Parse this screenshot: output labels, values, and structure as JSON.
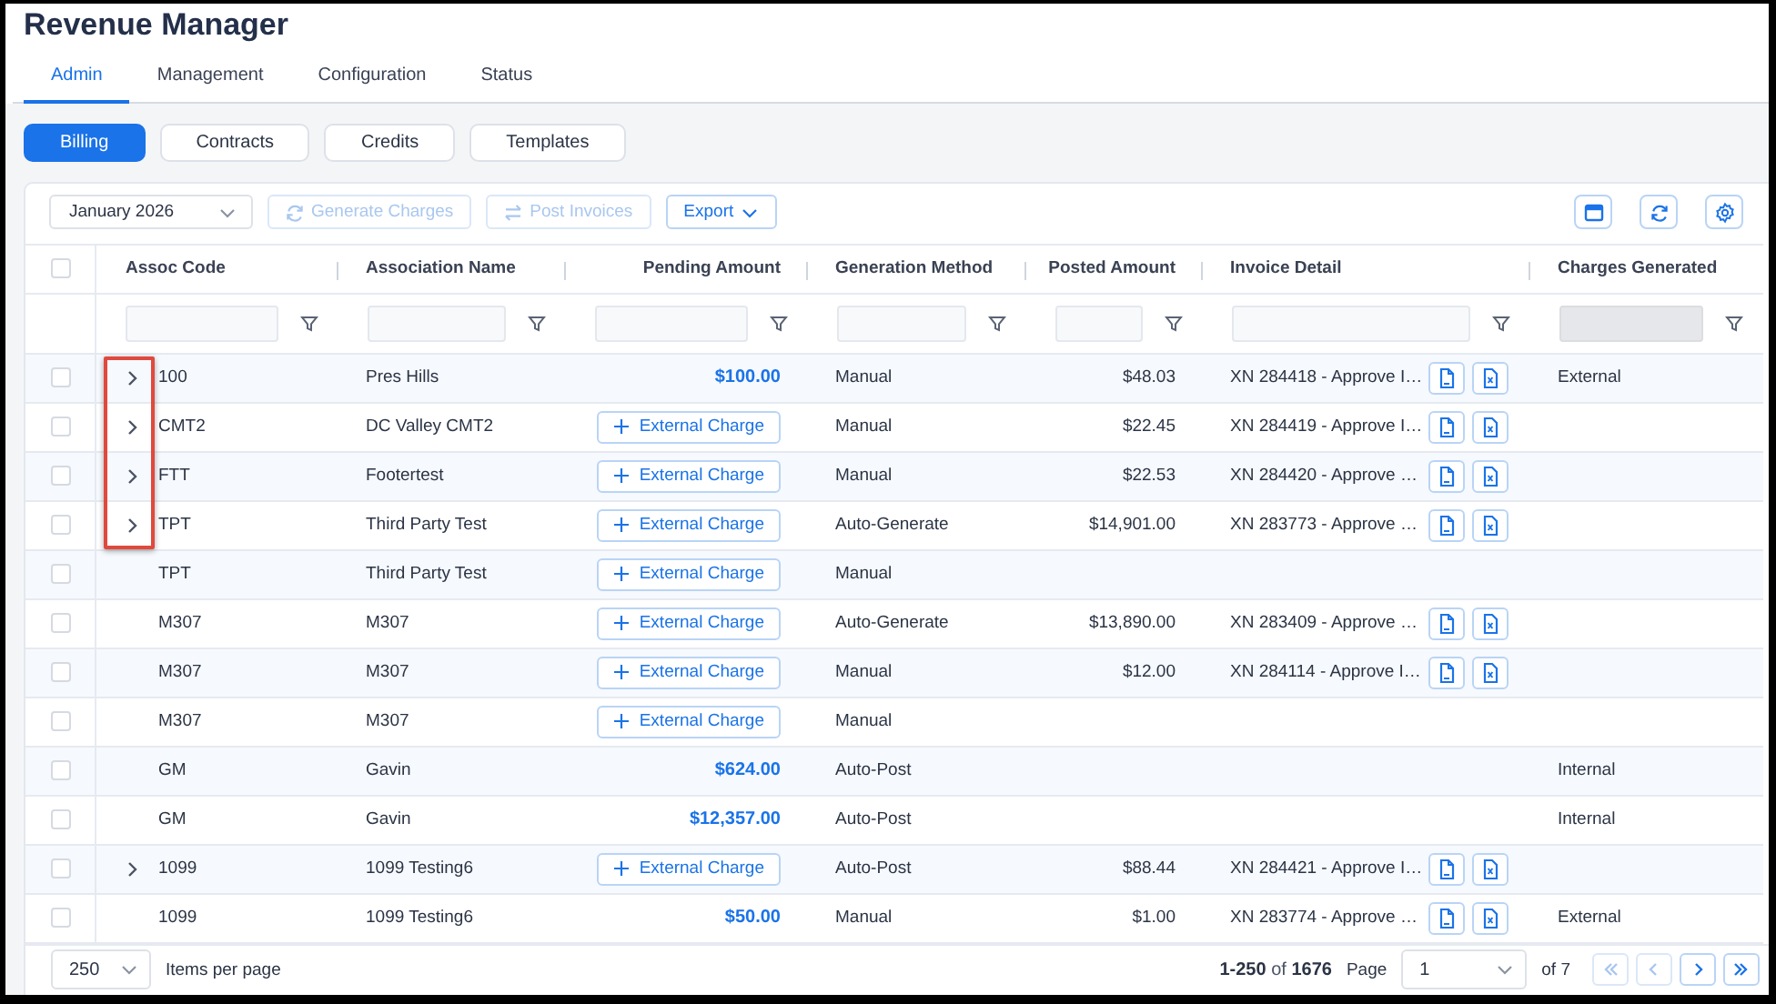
{
  "title": "Revenue Manager",
  "tabs": [
    {
      "label": "Admin",
      "selected": true
    },
    {
      "label": "Management",
      "selected": false
    },
    {
      "label": "Configuration",
      "selected": false
    },
    {
      "label": "Status",
      "selected": false
    }
  ],
  "subtabs": [
    {
      "label": "Billing",
      "selected": true
    },
    {
      "label": "Contracts",
      "selected": false
    },
    {
      "label": "Credits",
      "selected": false
    },
    {
      "label": "Templates",
      "selected": false
    }
  ],
  "toolbar": {
    "period": "January 2026",
    "actions": [
      {
        "kind": "generate",
        "label": "Generate Charges",
        "disabled": true
      },
      {
        "kind": "post",
        "label": "Post Invoices",
        "disabled": true
      },
      {
        "kind": "export",
        "label": "Export",
        "disabled": false
      }
    ]
  },
  "table": {
    "select_all_checked": false,
    "columns": [
      {
        "label": "Assoc Code",
        "filter_disabled": false
      },
      {
        "label": "Association Name",
        "filter_disabled": false
      },
      {
        "label": "Pending Amount",
        "filter_disabled": false
      },
      {
        "label": "Generation Method",
        "filter_disabled": false
      },
      {
        "label": "Posted Amount",
        "filter_disabled": false
      },
      {
        "label": "Invoice Detail",
        "filter_disabled": false
      },
      {
        "label": "Charges Generated",
        "filter_disabled": true
      }
    ],
    "rows": [
      {
        "checked": false,
        "expandable": true,
        "expanded": false,
        "highlighted": true,
        "assoc_code": "100",
        "association_name": "Pres Hills",
        "pending_amount": {
          "kind": "amount",
          "text": "$100.00"
        },
        "generation_method": "Manual",
        "posted_amount": "$48.03",
        "invoice_detail": "XN 284418 - Approve I…",
        "charges_generated": "External"
      },
      {
        "checked": false,
        "expandable": true,
        "expanded": false,
        "highlighted": true,
        "assoc_code": "CMT2",
        "association_name": "DC Valley CMT2",
        "pending_amount": {
          "kind": "button",
          "text": "External Charge"
        },
        "generation_method": "Manual",
        "posted_amount": "$22.45",
        "invoice_detail": "XN 284419 - Approve I…"
      },
      {
        "checked": false,
        "expandable": true,
        "expanded": false,
        "highlighted": true,
        "assoc_code": "FTT",
        "association_name": "Footertest",
        "pending_amount": {
          "kind": "button",
          "text": "External Charge"
        },
        "generation_method": "Manual",
        "posted_amount": "$22.53",
        "invoice_detail": "XN 284420 - Approve …"
      },
      {
        "checked": false,
        "expandable": true,
        "expanded": false,
        "highlighted": true,
        "assoc_code": "TPT",
        "association_name": "Third Party Test",
        "pending_amount": {
          "kind": "button",
          "text": "External Charge"
        },
        "generation_method": "Auto-Generate",
        "posted_amount": "$14,901.00",
        "invoice_detail": "XN 283773 - Approve …"
      },
      {
        "checked": false,
        "expandable": false,
        "highlighted": false,
        "assoc_code": "TPT",
        "association_name": "Third Party Test",
        "pending_amount": {
          "kind": "button",
          "text": "External Charge"
        },
        "generation_method": "Manual"
      },
      {
        "checked": false,
        "expandable": false,
        "highlighted": false,
        "assoc_code": "M307",
        "association_name": "M307",
        "pending_amount": {
          "kind": "button",
          "text": "External Charge"
        },
        "generation_method": "Auto-Generate",
        "posted_amount": "$13,890.00",
        "invoice_detail": "XN 283409 - Approve …"
      },
      {
        "checked": false,
        "expandable": false,
        "highlighted": false,
        "assoc_code": "M307",
        "association_name": "M307",
        "pending_amount": {
          "kind": "button",
          "text": "External Charge"
        },
        "generation_method": "Manual",
        "posted_amount": "$12.00",
        "invoice_detail": "XN 284114 - Approve I…"
      },
      {
        "checked": false,
        "expandable": false,
        "highlighted": false,
        "assoc_code": "M307",
        "association_name": "M307",
        "pending_amount": {
          "kind": "button",
          "text": "External Charge"
        },
        "generation_method": "Manual"
      },
      {
        "checked": false,
        "expandable": false,
        "highlighted": false,
        "assoc_code": "GM",
        "association_name": "Gavin",
        "pending_amount": {
          "kind": "amount",
          "text": "$624.00"
        },
        "generation_method": "Auto-Post",
        "charges_generated": "Internal"
      },
      {
        "checked": false,
        "expandable": false,
        "highlighted": false,
        "assoc_code": "GM",
        "association_name": "Gavin",
        "pending_amount": {
          "kind": "amount",
          "text": "$12,357.00"
        },
        "generation_method": "Auto-Post",
        "charges_generated": "Internal"
      },
      {
        "checked": false,
        "expandable": true,
        "expanded": false,
        "highlighted": false,
        "assoc_code": "1099",
        "association_name": "1099 Testing6",
        "pending_amount": {
          "kind": "button",
          "text": "External Charge"
        },
        "generation_method": "Auto-Post",
        "posted_amount": "$88.44",
        "invoice_detail": "XN 284421 - Approve I…"
      },
      {
        "checked": false,
        "expandable": false,
        "highlighted": false,
        "assoc_code": "1099",
        "association_name": "1099 Testing6",
        "pending_amount": {
          "kind": "amount",
          "text": "$50.00"
        },
        "generation_method": "Manual",
        "posted_amount": "$1.00",
        "invoice_detail": "XN 283774 - Approve …",
        "charges_generated": "External"
      }
    ]
  },
  "footer": {
    "page_size": "250",
    "page_size_label": "Items per page",
    "range": "**1-250** of **1676**",
    "page_label": "Page",
    "page": "1",
    "page_count": "of 7",
    "nav": [
      {
        "kind": "first",
        "disabled": true
      },
      {
        "kind": "prev",
        "disabled": true
      },
      {
        "kind": "next",
        "disabled": false
      },
      {
        "kind": "last",
        "disabled": false
      }
    ]
  }
}
